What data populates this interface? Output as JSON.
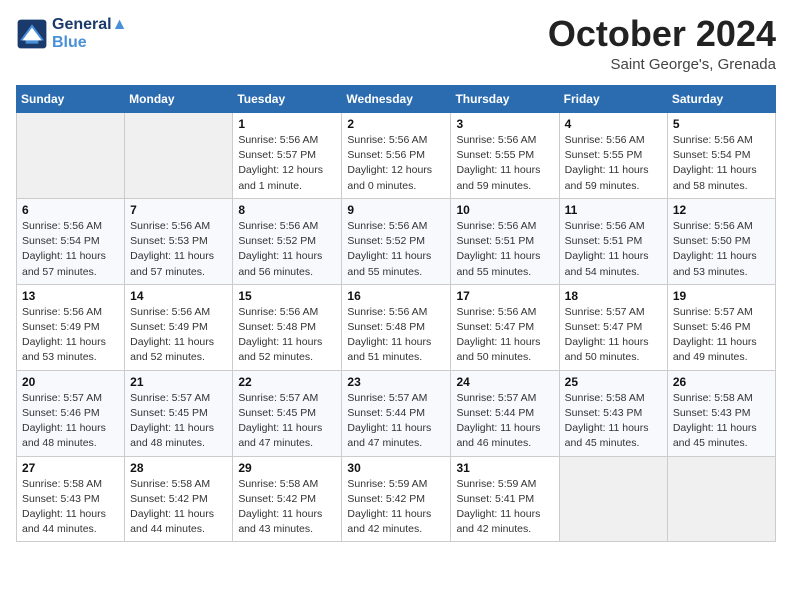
{
  "logo": {
    "line1": "General",
    "line2": "Blue"
  },
  "title": "October 2024",
  "location": "Saint George's, Grenada",
  "headers": [
    "Sunday",
    "Monday",
    "Tuesday",
    "Wednesday",
    "Thursday",
    "Friday",
    "Saturday"
  ],
  "weeks": [
    [
      {
        "day": "",
        "info": ""
      },
      {
        "day": "",
        "info": ""
      },
      {
        "day": "1",
        "info": "Sunrise: 5:56 AM\nSunset: 5:57 PM\nDaylight: 12 hours\nand 1 minute."
      },
      {
        "day": "2",
        "info": "Sunrise: 5:56 AM\nSunset: 5:56 PM\nDaylight: 12 hours\nand 0 minutes."
      },
      {
        "day": "3",
        "info": "Sunrise: 5:56 AM\nSunset: 5:55 PM\nDaylight: 11 hours\nand 59 minutes."
      },
      {
        "day": "4",
        "info": "Sunrise: 5:56 AM\nSunset: 5:55 PM\nDaylight: 11 hours\nand 59 minutes."
      },
      {
        "day": "5",
        "info": "Sunrise: 5:56 AM\nSunset: 5:54 PM\nDaylight: 11 hours\nand 58 minutes."
      }
    ],
    [
      {
        "day": "6",
        "info": "Sunrise: 5:56 AM\nSunset: 5:54 PM\nDaylight: 11 hours\nand 57 minutes."
      },
      {
        "day": "7",
        "info": "Sunrise: 5:56 AM\nSunset: 5:53 PM\nDaylight: 11 hours\nand 57 minutes."
      },
      {
        "day": "8",
        "info": "Sunrise: 5:56 AM\nSunset: 5:52 PM\nDaylight: 11 hours\nand 56 minutes."
      },
      {
        "day": "9",
        "info": "Sunrise: 5:56 AM\nSunset: 5:52 PM\nDaylight: 11 hours\nand 55 minutes."
      },
      {
        "day": "10",
        "info": "Sunrise: 5:56 AM\nSunset: 5:51 PM\nDaylight: 11 hours\nand 55 minutes."
      },
      {
        "day": "11",
        "info": "Sunrise: 5:56 AM\nSunset: 5:51 PM\nDaylight: 11 hours\nand 54 minutes."
      },
      {
        "day": "12",
        "info": "Sunrise: 5:56 AM\nSunset: 5:50 PM\nDaylight: 11 hours\nand 53 minutes."
      }
    ],
    [
      {
        "day": "13",
        "info": "Sunrise: 5:56 AM\nSunset: 5:49 PM\nDaylight: 11 hours\nand 53 minutes."
      },
      {
        "day": "14",
        "info": "Sunrise: 5:56 AM\nSunset: 5:49 PM\nDaylight: 11 hours\nand 52 minutes."
      },
      {
        "day": "15",
        "info": "Sunrise: 5:56 AM\nSunset: 5:48 PM\nDaylight: 11 hours\nand 52 minutes."
      },
      {
        "day": "16",
        "info": "Sunrise: 5:56 AM\nSunset: 5:48 PM\nDaylight: 11 hours\nand 51 minutes."
      },
      {
        "day": "17",
        "info": "Sunrise: 5:56 AM\nSunset: 5:47 PM\nDaylight: 11 hours\nand 50 minutes."
      },
      {
        "day": "18",
        "info": "Sunrise: 5:57 AM\nSunset: 5:47 PM\nDaylight: 11 hours\nand 50 minutes."
      },
      {
        "day": "19",
        "info": "Sunrise: 5:57 AM\nSunset: 5:46 PM\nDaylight: 11 hours\nand 49 minutes."
      }
    ],
    [
      {
        "day": "20",
        "info": "Sunrise: 5:57 AM\nSunset: 5:46 PM\nDaylight: 11 hours\nand 48 minutes."
      },
      {
        "day": "21",
        "info": "Sunrise: 5:57 AM\nSunset: 5:45 PM\nDaylight: 11 hours\nand 48 minutes."
      },
      {
        "day": "22",
        "info": "Sunrise: 5:57 AM\nSunset: 5:45 PM\nDaylight: 11 hours\nand 47 minutes."
      },
      {
        "day": "23",
        "info": "Sunrise: 5:57 AM\nSunset: 5:44 PM\nDaylight: 11 hours\nand 47 minutes."
      },
      {
        "day": "24",
        "info": "Sunrise: 5:57 AM\nSunset: 5:44 PM\nDaylight: 11 hours\nand 46 minutes."
      },
      {
        "day": "25",
        "info": "Sunrise: 5:58 AM\nSunset: 5:43 PM\nDaylight: 11 hours\nand 45 minutes."
      },
      {
        "day": "26",
        "info": "Sunrise: 5:58 AM\nSunset: 5:43 PM\nDaylight: 11 hours\nand 45 minutes."
      }
    ],
    [
      {
        "day": "27",
        "info": "Sunrise: 5:58 AM\nSunset: 5:43 PM\nDaylight: 11 hours\nand 44 minutes."
      },
      {
        "day": "28",
        "info": "Sunrise: 5:58 AM\nSunset: 5:42 PM\nDaylight: 11 hours\nand 44 minutes."
      },
      {
        "day": "29",
        "info": "Sunrise: 5:58 AM\nSunset: 5:42 PM\nDaylight: 11 hours\nand 43 minutes."
      },
      {
        "day": "30",
        "info": "Sunrise: 5:59 AM\nSunset: 5:42 PM\nDaylight: 11 hours\nand 42 minutes."
      },
      {
        "day": "31",
        "info": "Sunrise: 5:59 AM\nSunset: 5:41 PM\nDaylight: 11 hours\nand 42 minutes."
      },
      {
        "day": "",
        "info": ""
      },
      {
        "day": "",
        "info": ""
      }
    ]
  ]
}
